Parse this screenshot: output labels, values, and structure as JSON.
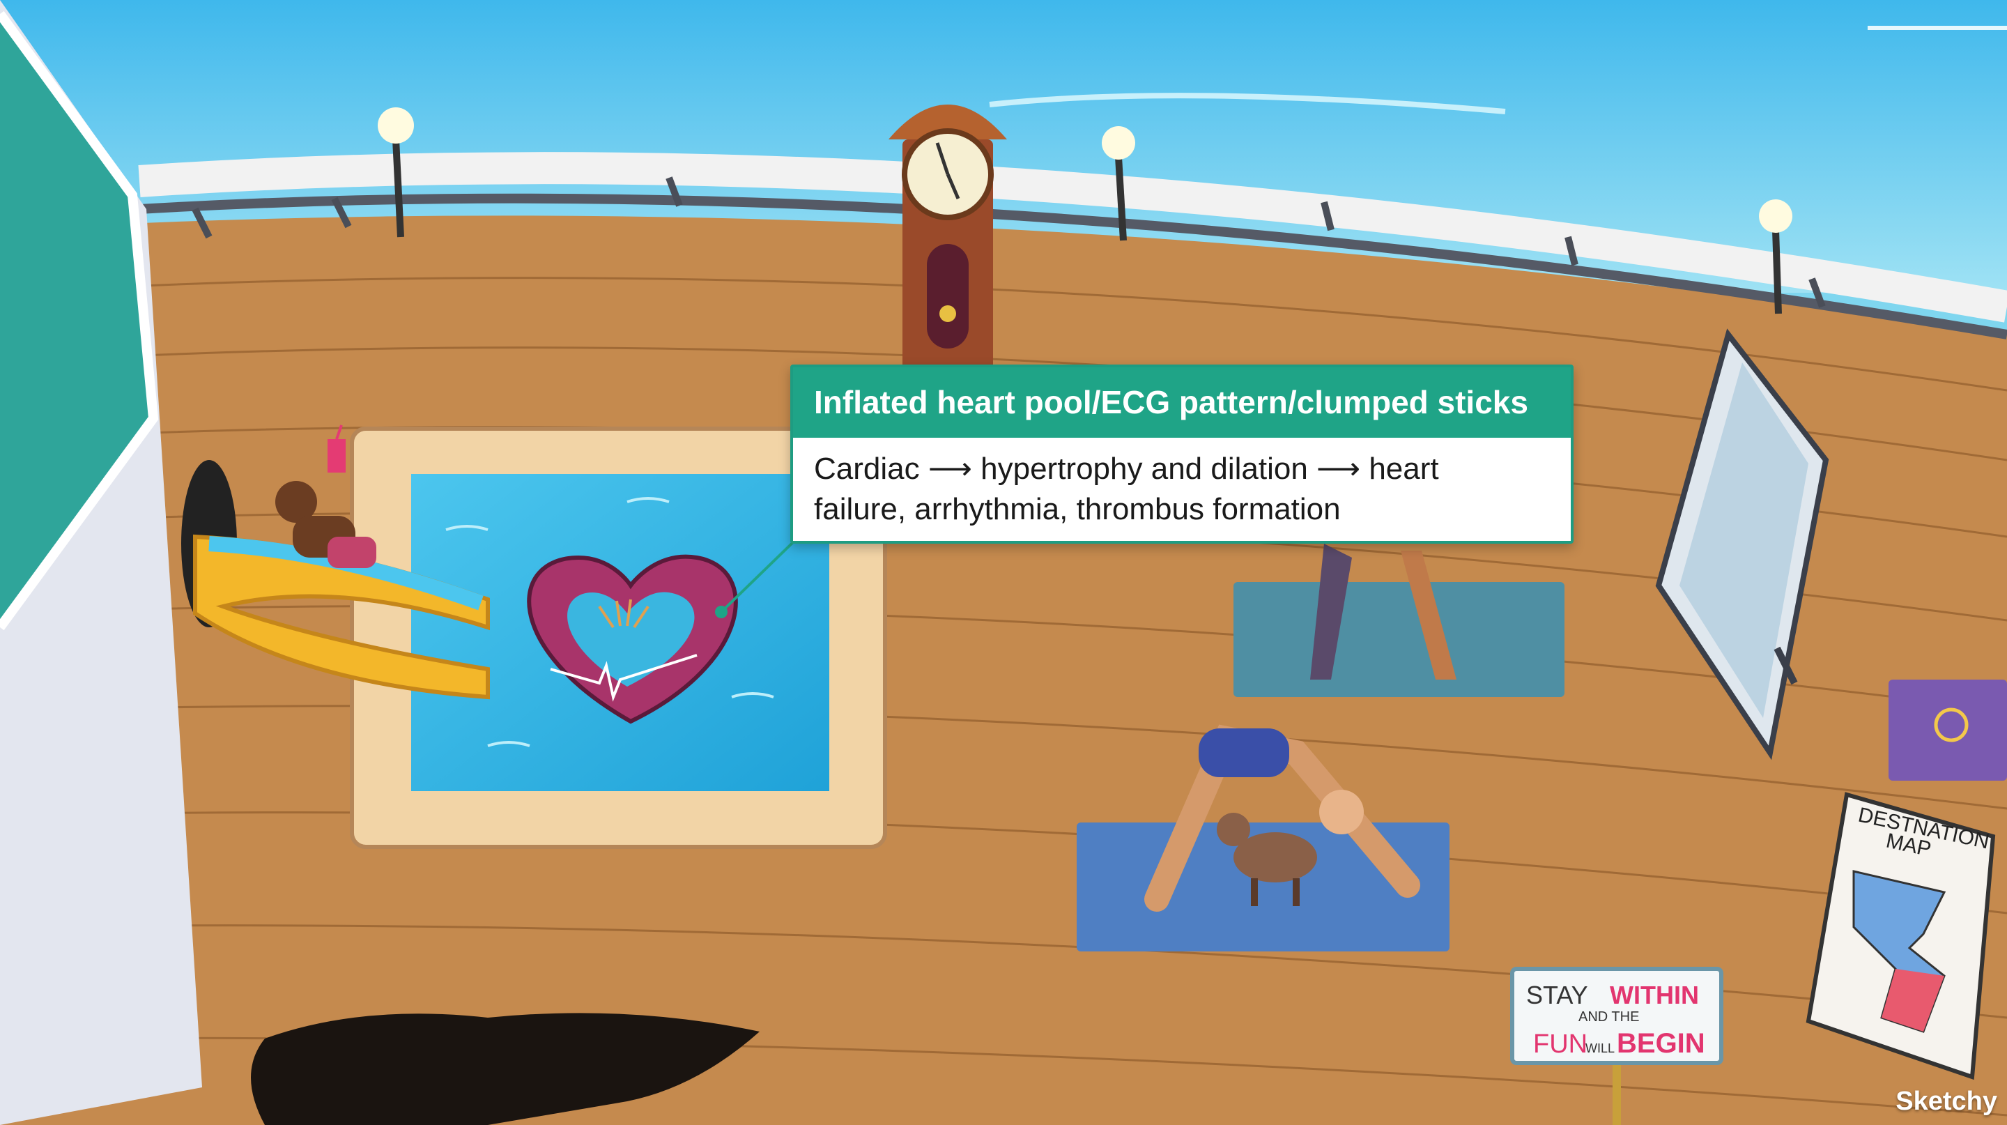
{
  "callout": {
    "title": "Inflated heart pool/ECG pattern/clumped sticks",
    "line1": "Cardiac ⟶ hypertrophy and dilation ⟶ heart",
    "line2": "failure, arrhythmia, thrombus formation"
  },
  "sign": {
    "stay": "STAY",
    "within": "WITHIN",
    "and_the": "AND THE",
    "fun": "FUN",
    "will": "WILL",
    "begin": "BEGIN"
  },
  "map_board": {
    "line1": "DESTNATION",
    "line2": "MAP"
  },
  "watermark": "Sketchy",
  "colors": {
    "accent": "#1fa487",
    "sky": "#7fd6ef",
    "deck": "#c58a4e",
    "pool": "#35b8e6"
  }
}
